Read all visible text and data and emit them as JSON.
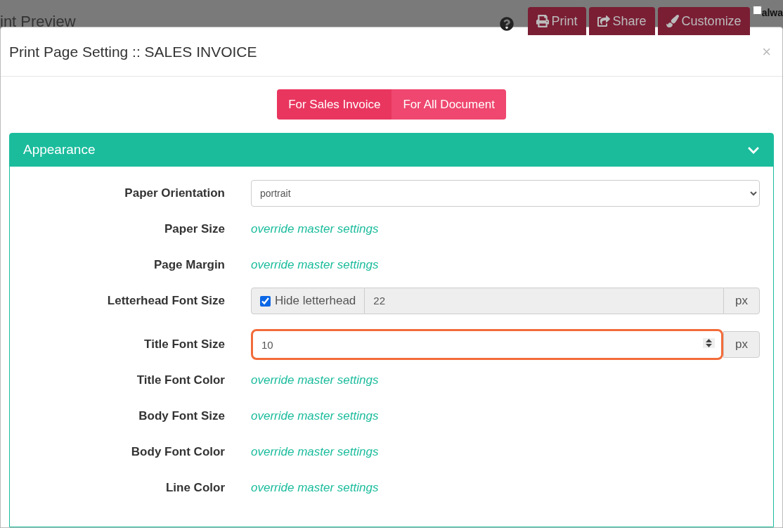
{
  "background": {
    "title": "int Preview",
    "buttons": [
      {
        "kind": "print",
        "label": "Print"
      },
      {
        "kind": "share",
        "label": "Share"
      },
      {
        "kind": "customize",
        "label": "Customize"
      }
    ],
    "checkbox": {
      "label": "alwa",
      "checked": false
    }
  },
  "modal": {
    "title": "Print Page Setting :: SALES INVOICE",
    "close": "×",
    "tabs": [
      {
        "label": "For Sales Invoice",
        "selected": true
      },
      {
        "label": "For All Document",
        "selected": false
      }
    ],
    "section": {
      "title": "Appearance",
      "expanded": true,
      "rows": [
        {
          "kind": "select",
          "label": "Paper Orientation",
          "value": "portrait"
        },
        {
          "kind": "link",
          "label": "Paper Size",
          "value": "override master settings"
        },
        {
          "kind": "link",
          "label": "Page Margin",
          "value": "override master settings"
        },
        {
          "kind": "checkbox-input",
          "label": "Letterhead Font Size",
          "check_label": "Hide letterhead",
          "checked": true,
          "value": "22",
          "unit": "px",
          "disabled": true
        },
        {
          "kind": "number",
          "label": "Title Font Size",
          "value": "10",
          "unit": "px",
          "focused": true
        },
        {
          "kind": "link",
          "label": "Title Font Color",
          "value": "override master settings"
        },
        {
          "kind": "link",
          "label": "Body Font Size",
          "value": "override master settings"
        },
        {
          "kind": "link",
          "label": "Body Font Color",
          "value": "override master settings"
        },
        {
          "kind": "link",
          "label": "Line Color",
          "value": "override master settings"
        }
      ]
    }
  }
}
